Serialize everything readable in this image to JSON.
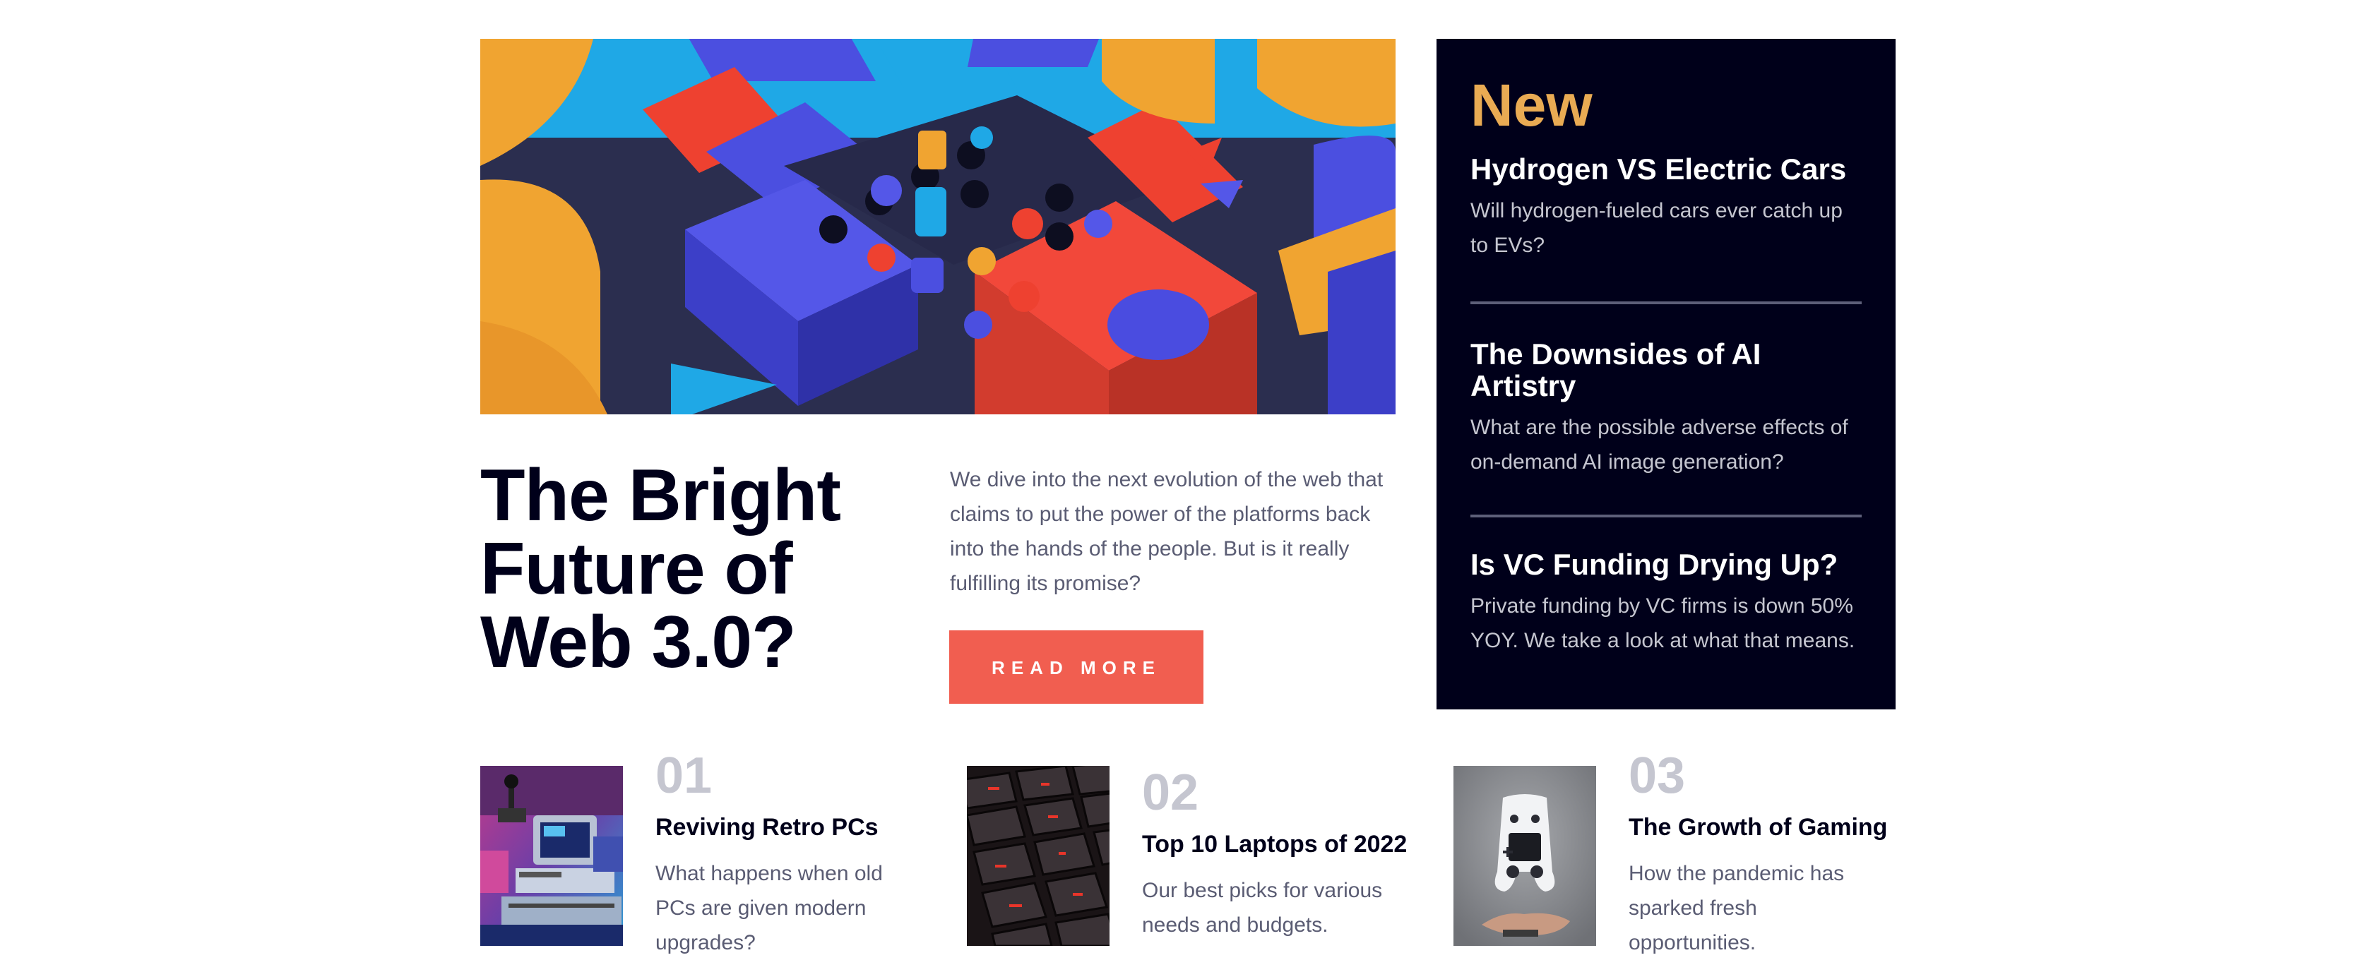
{
  "hero": {
    "image_alt": "Colorful 3D geometric blocks",
    "title_line1": "The Bright",
    "title_line2": "Future of",
    "title_line3": "Web 3.0?",
    "description": "We dive into the next evolution of the web that claims to put the power of the platforms back into the hands of the people. But is it really fulfilling its promise?",
    "button_label": "READ MORE"
  },
  "new_panel": {
    "heading": "New",
    "items": [
      {
        "title": "Hydrogen VS Electric Cars",
        "description": "Will hydrogen-fueled cars ever catch up to EVs?"
      },
      {
        "title": "The Downsides of AI Artistry",
        "description": "What are the possible adverse effects of on-demand AI image generation?"
      },
      {
        "title": "Is VC Funding Drying Up?",
        "description": "Private funding by VC firms is down 50% YOY. We take a look at what that means."
      }
    ]
  },
  "articles": [
    {
      "number": "01",
      "title": "Reviving Retro PCs",
      "description": "What happens when old PCs are given modern upgrades?",
      "image": "retro-pc-photo"
    },
    {
      "number": "02",
      "title": "Top 10 Laptops of 2022",
      "description": "Our best picks for various needs and budgets.",
      "image": "keyboard-photo"
    },
    {
      "number": "03",
      "title": "The Growth of Gaming",
      "description": "How the pandemic has sparked fresh opportunities.",
      "image": "game-controller-photo"
    }
  ],
  "colors": {
    "dark_navy": "#00001a",
    "accent_orange": "#e9ab53",
    "button_red": "#f15e50",
    "muted_text": "#5a5c73",
    "number_gray": "#c5c6d0"
  }
}
